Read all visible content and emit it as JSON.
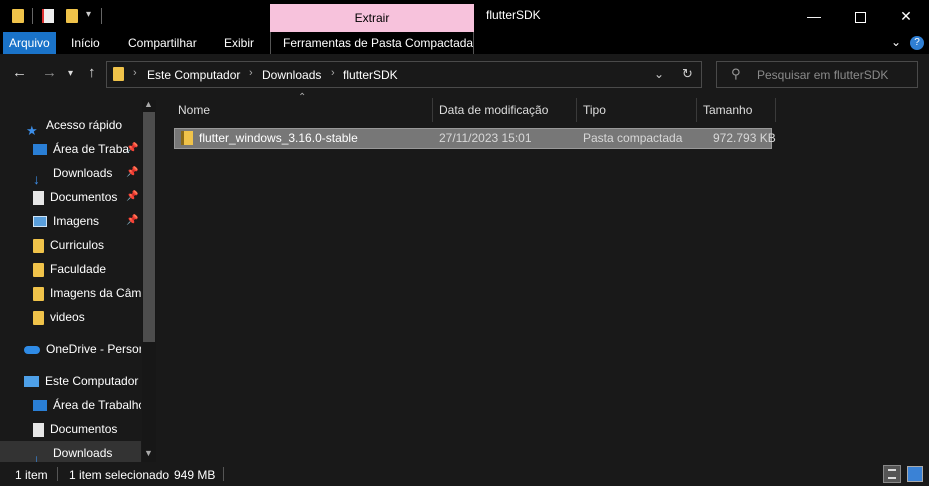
{
  "title_bar": {
    "window_title": "flutterSDK",
    "contextual_tab": "Extrair"
  },
  "ribbon": {
    "tabs": [
      "Arquivo",
      "Início",
      "Compartilhar",
      "Exibir",
      "Ferramentas de Pasta Compactada"
    ]
  },
  "address": {
    "breadcrumbs": [
      "Este Computador",
      "Downloads",
      "flutterSDK"
    ],
    "search_placeholder": "Pesquisar em flutterSDK"
  },
  "nav_pane": {
    "quick_access": "Acesso rápido",
    "pinned": [
      {
        "label": "Área de Traba",
        "icon": "desktop-icon"
      },
      {
        "label": "Downloads",
        "icon": "downloads-icon"
      },
      {
        "label": "Documentos",
        "icon": "documents-icon"
      },
      {
        "label": "Imagens",
        "icon": "pictures-icon"
      }
    ],
    "folders": [
      "Curriculos",
      "Faculdade",
      "Imagens da Câm",
      "videos"
    ],
    "onedrive": "OneDrive - Persor",
    "this_pc": "Este Computador",
    "pc_items": [
      "Área de Trabalhc",
      "Documentos",
      "Downloads"
    ]
  },
  "file_list": {
    "columns": [
      "Nome",
      "Data de modificação",
      "Tipo",
      "Tamanho"
    ],
    "rows": [
      {
        "name": "flutter_windows_3.16.0-stable",
        "date": "27/11/2023 15:01",
        "type": "Pasta compactada",
        "size": "972.793 KB"
      }
    ]
  },
  "status_bar": {
    "item_count": "1 item",
    "selected": "1 item selecionado",
    "selected_size": "949 MB"
  },
  "colors": {
    "accent": "#1a73c9",
    "contextual": "#f7c2dc",
    "background": "#191919",
    "selection": "#777777"
  }
}
